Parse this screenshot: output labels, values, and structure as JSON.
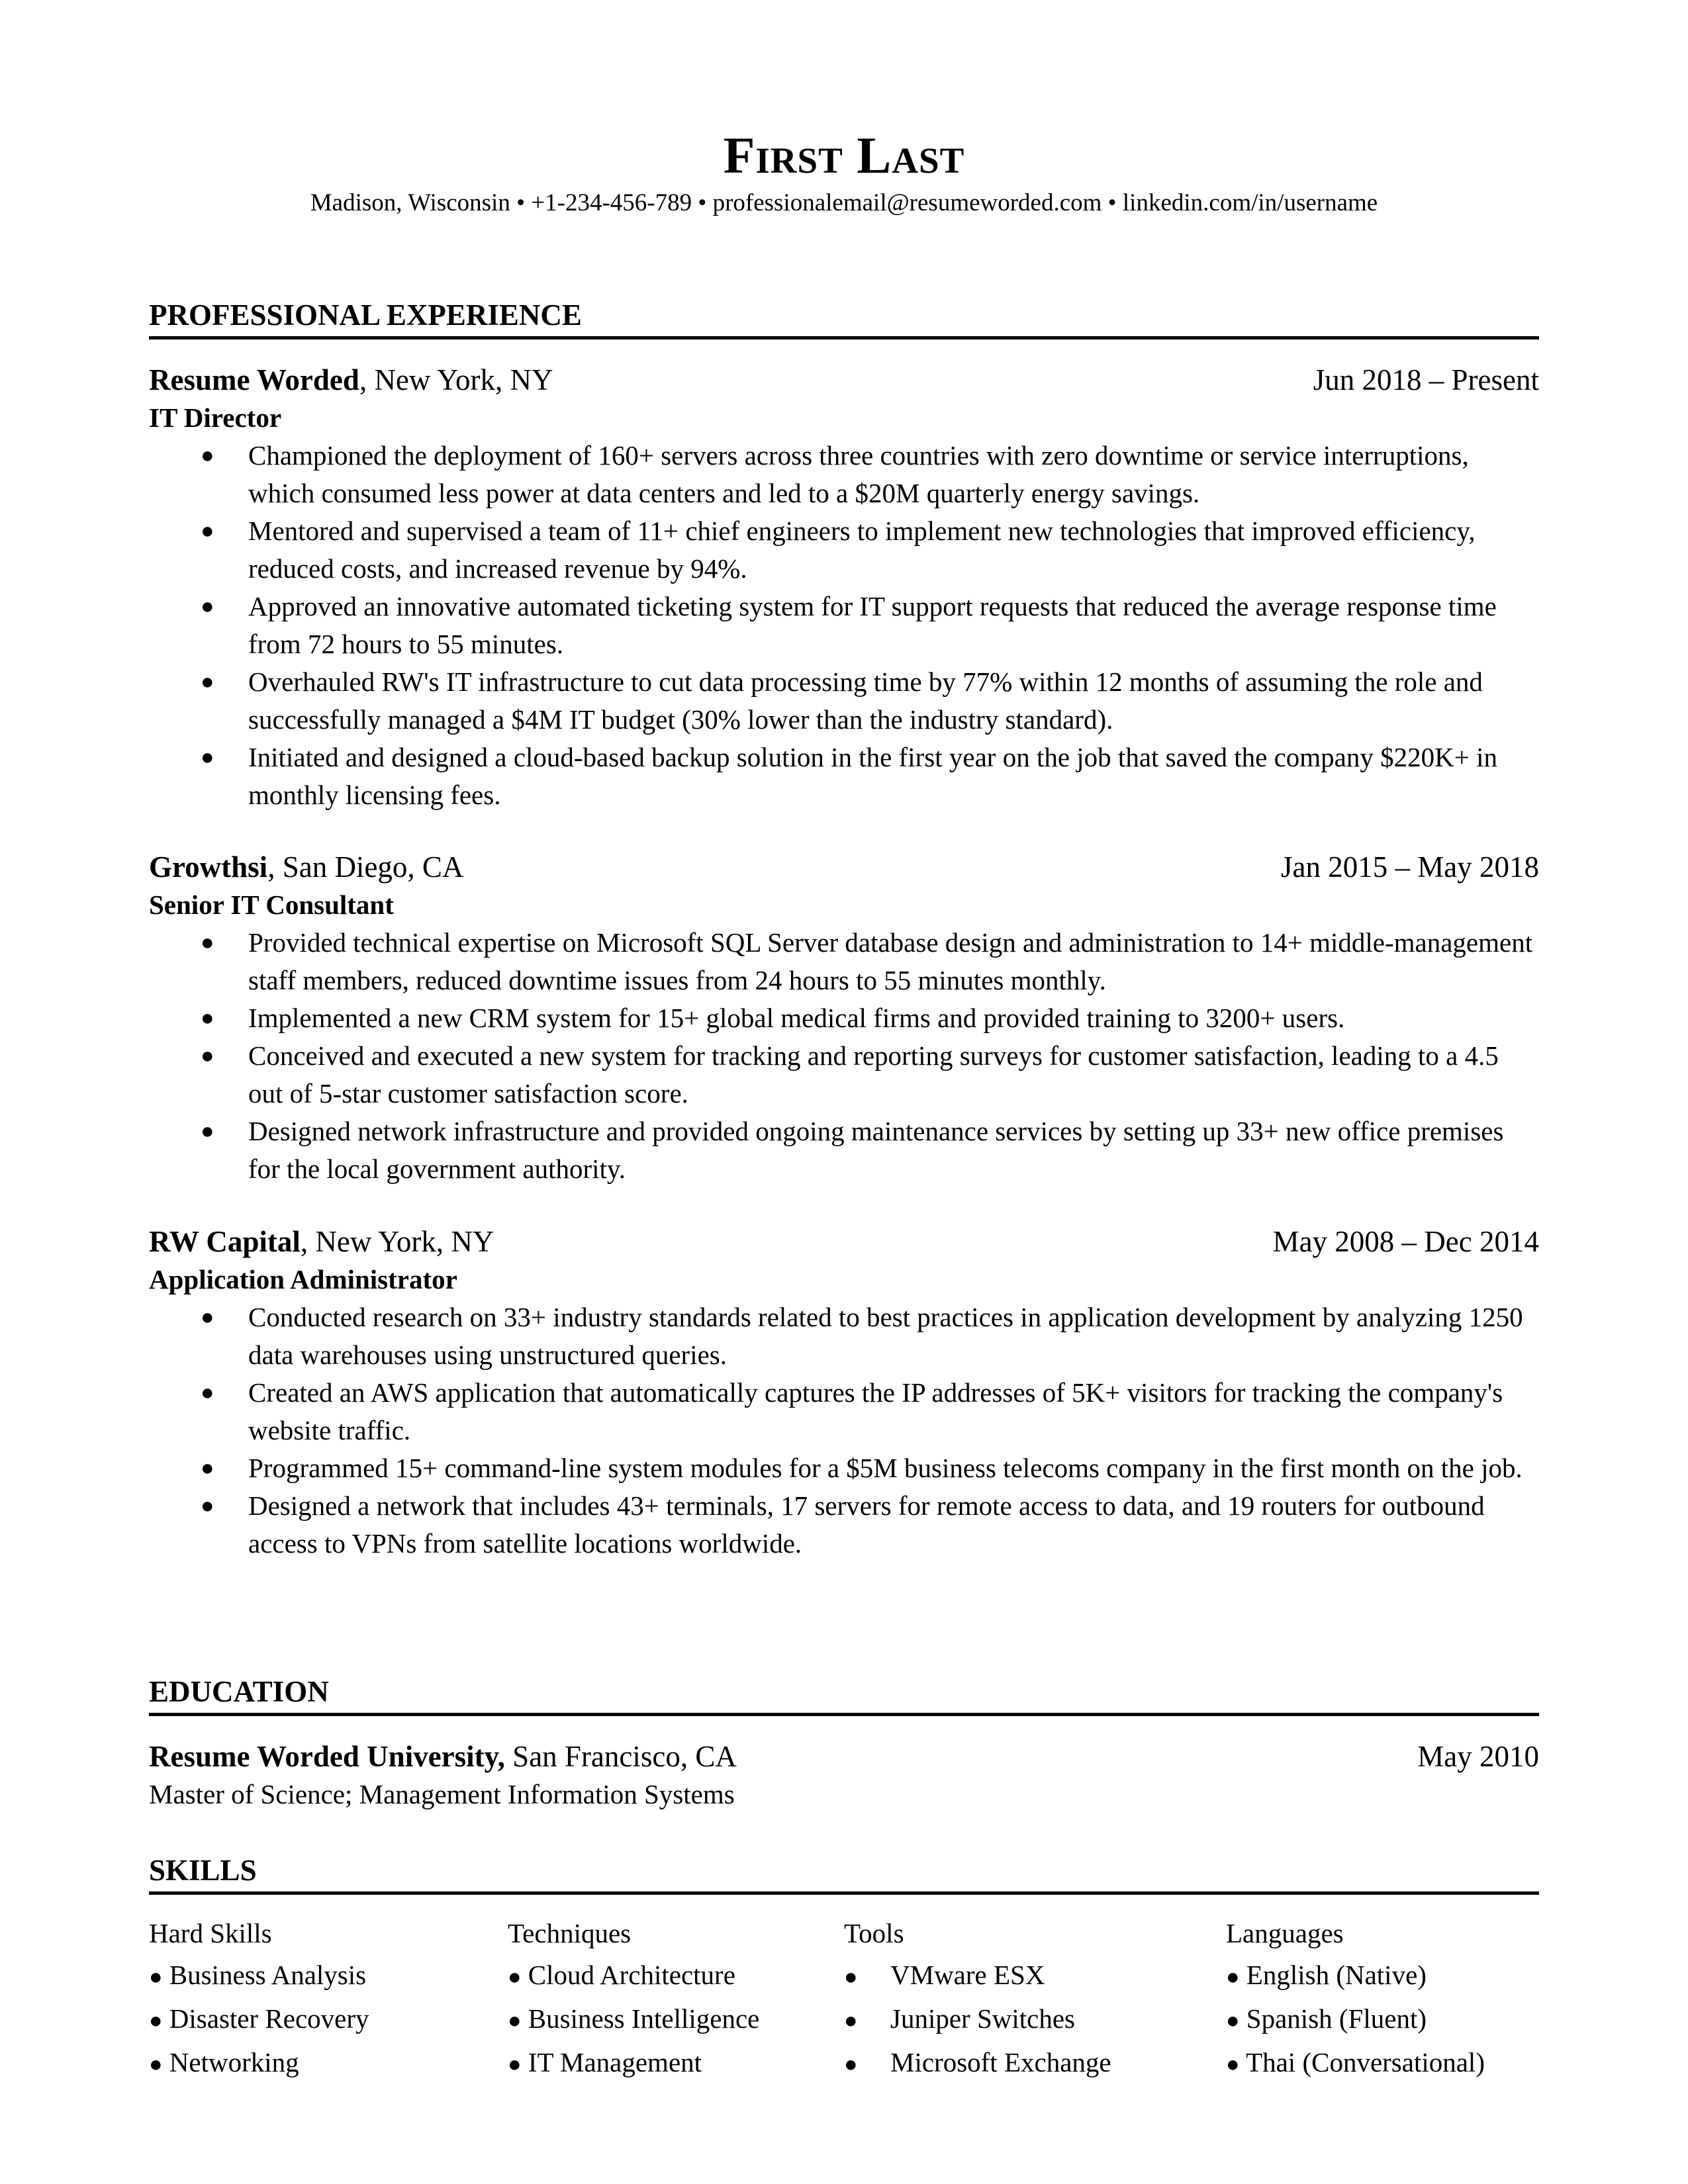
{
  "header": {
    "name": "First Last",
    "contact": "Madison, Wisconsin • +1-234-456-789 • professionalemail@resumeworded.com • linkedin.com/in/username"
  },
  "sections": {
    "experience": "PROFESSIONAL EXPERIENCE",
    "education": "EDUCATION",
    "skills": "SKILLS"
  },
  "bullet_glyph": "●",
  "jobs": [
    {
      "company": "Resume Worded",
      "location": ", New York, NY",
      "dates": "Jun 2018 – Present",
      "role": "IT Director",
      "bullets": [
        "Championed the deployment of 160+ servers across three countries with zero downtime or service interruptions, which consumed less power at data centers and led to a $20M quarterly energy savings.",
        "Mentored and supervised a team of 11+ chief engineers to implement new technologies that improved efficiency, reduced costs, and increased revenue by 94%.",
        "Approved an innovative automated ticketing system for IT support requests that reduced the average response time from 72 hours to 55 minutes.",
        "Overhauled RW's IT infrastructure to cut data processing time by 77% within 12 months of assuming the role and successfully managed a $4M IT budget (30% lower than the industry standard).",
        "Initiated and designed a cloud-based backup solution in the first year on the job that saved the company $220K+ in monthly licensing fees."
      ]
    },
    {
      "company": "Growthsi",
      "location": ", San Diego, CA",
      "dates": "Jan 2015 – May 2018",
      "role": "Senior IT Consultant",
      "bullets": [
        "Provided technical expertise on Microsoft SQL Server database design and administration to 14+ middle-management staff members, reduced downtime issues from 24 hours to 55 minutes monthly.",
        "Implemented a new CRM system for 15+ global medical firms and provided training to 3200+ users.",
        "Conceived and executed a new system for tracking and reporting surveys for customer satisfaction, leading to a 4.5 out of 5-star customer satisfaction score.",
        "Designed network infrastructure and provided ongoing maintenance services by setting up 33+ new office premises for the local government authority."
      ]
    },
    {
      "company": "RW Capital",
      "location": ", New York, NY",
      "dates": "May 2008 – Dec 2014",
      "role": "Application Administrator",
      "bullets": [
        "Conducted research on 33+ industry standards related to best practices in application development by analyzing 1250 data warehouses using unstructured queries.",
        "Created an AWS application that automatically captures the IP addresses of 5K+ visitors for tracking the company's website traffic.",
        "Programmed 15+ command-line system modules for a $5M business telecoms company in the first month on the job.",
        "Designed a network that includes 43+ terminals, 17 servers for remote access to data, and 19 routers for outbound access to VPNs from satellite locations worldwide."
      ]
    }
  ],
  "education": {
    "school": "Resume Worded University,",
    "location": " San Francisco, CA",
    "date": "May 2010",
    "degree": "Master of Science; Management Information Systems"
  },
  "skills": [
    {
      "heading": "Hard Skills",
      "items": [
        "Business Analysis",
        "Disaster Recovery",
        "Networking"
      ]
    },
    {
      "heading": "Techniques",
      "items": [
        "Cloud Architecture",
        "Business Intelligence",
        "IT Management"
      ]
    },
    {
      "heading": "Tools",
      "items": [
        "VMware ESX",
        "Juniper Switches",
        "Microsoft Exchange"
      ]
    },
    {
      "heading": "Languages",
      "items": [
        "English (Native)",
        "Spanish (Fluent)",
        "Thai (Conversational)"
      ]
    }
  ]
}
